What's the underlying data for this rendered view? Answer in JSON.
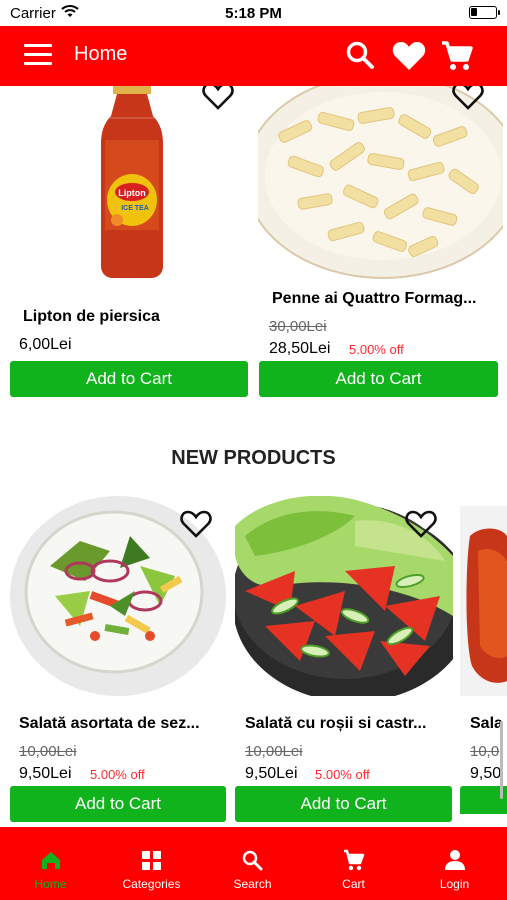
{
  "status_bar": {
    "carrier": "Carrier",
    "time": "5:18 PM"
  },
  "header": {
    "title": "Home"
  },
  "top_products": [
    {
      "name": "Lipton de piersica",
      "price": "6,00Lei",
      "old_price": "",
      "discount": "",
      "button": "Add to Cart"
    },
    {
      "name": "Penne ai Quattro Formag...",
      "price": "28,50Lei",
      "old_price": "30,00Lei",
      "discount": "5.00% off",
      "button": "Add to Cart"
    }
  ],
  "new_products": {
    "title": "NEW PRODUCTS",
    "items": [
      {
        "name": "Salată asortata de sez...",
        "price": "9,50Lei",
        "old_price": "10,00Lei",
        "discount": "5.00% off",
        "button": "Add to Cart"
      },
      {
        "name": "Salată cu roșii si castr...",
        "price": "9,50Lei",
        "old_price": "10,00Lei",
        "discount": "5.00% off",
        "button": "Add to Cart"
      },
      {
        "name": "Sala",
        "price": "9,50",
        "old_price": "10,0",
        "discount": "",
        "button": ""
      }
    ]
  },
  "bottom_nav": [
    {
      "label": "Home",
      "icon": "home-icon",
      "active": true
    },
    {
      "label": "Categories",
      "icon": "categories-icon",
      "active": false
    },
    {
      "label": "Search",
      "icon": "search-icon",
      "active": false
    },
    {
      "label": "Cart",
      "icon": "cart-icon",
      "active": false
    },
    {
      "label": "Login",
      "icon": "person-icon",
      "active": false
    }
  ],
  "colors": {
    "primary": "#ff0000",
    "accent": "#11b31c",
    "discount": "#ff2a2a"
  }
}
